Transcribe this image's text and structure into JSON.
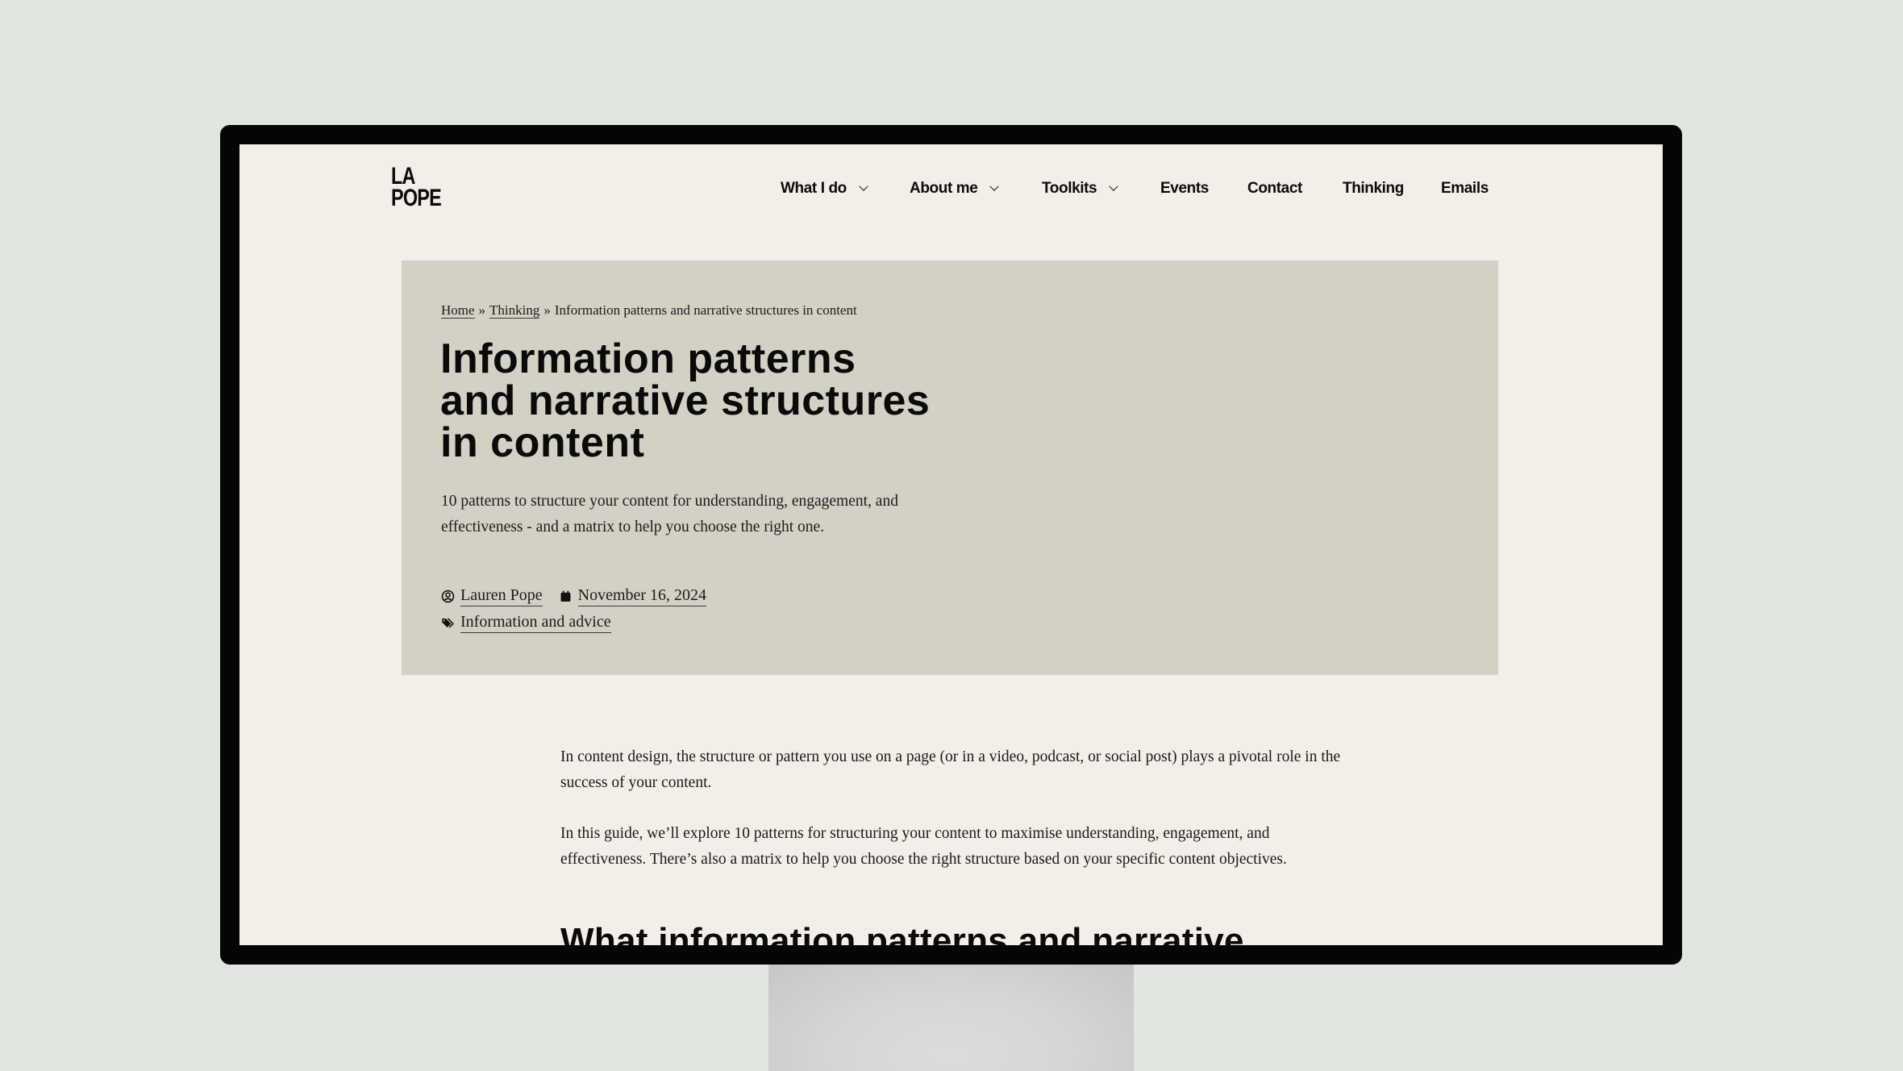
{
  "colors": {
    "backdrop": "#e1e6e0",
    "bezel": "#050505",
    "page_background": "#f4eee8",
    "hero_background": "#d3d0c4",
    "text": "#0a0a0a"
  },
  "header": {
    "logo_line1": "LA",
    "logo_line2": "POPE",
    "nav": [
      {
        "label": "What I do",
        "has_dropdown": true
      },
      {
        "label": "About me",
        "has_dropdown": true
      },
      {
        "label": "Toolkits",
        "has_dropdown": true
      },
      {
        "label": "Events",
        "has_dropdown": false
      },
      {
        "label": "Contact",
        "has_dropdown": false
      },
      {
        "label": "Thinking",
        "has_dropdown": false
      },
      {
        "label": "Emails",
        "has_dropdown": false
      }
    ]
  },
  "breadcrumb": {
    "items": [
      "Home",
      "Thinking"
    ],
    "separator": "»",
    "current": "Information patterns and narrative structures in content"
  },
  "hero": {
    "title": "Information patterns and narrative structures in content",
    "subtitle": "10 patterns to structure your content for understanding, engagement, and effectiveness - and a matrix to help you choose the right one.",
    "author": {
      "icon": "user-circle-icon",
      "label": "Lauren Pope"
    },
    "date": {
      "icon": "calendar-icon",
      "label": "November 16, 2024"
    },
    "category": {
      "icon": "tags-icon",
      "label": "Information and advice"
    }
  },
  "article": {
    "paragraphs": [
      "In content design, the structure or pattern you use on a page (or in a video, podcast, or social post) plays a pivotal role in the success of your content.",
      "In this guide, we’ll explore 10 patterns for structuring your content to maximise understanding, engagement, and effectiveness. There’s also a matrix to help you choose the right structure based on your specific content objectives."
    ],
    "heading": "What information patterns and narrative"
  }
}
